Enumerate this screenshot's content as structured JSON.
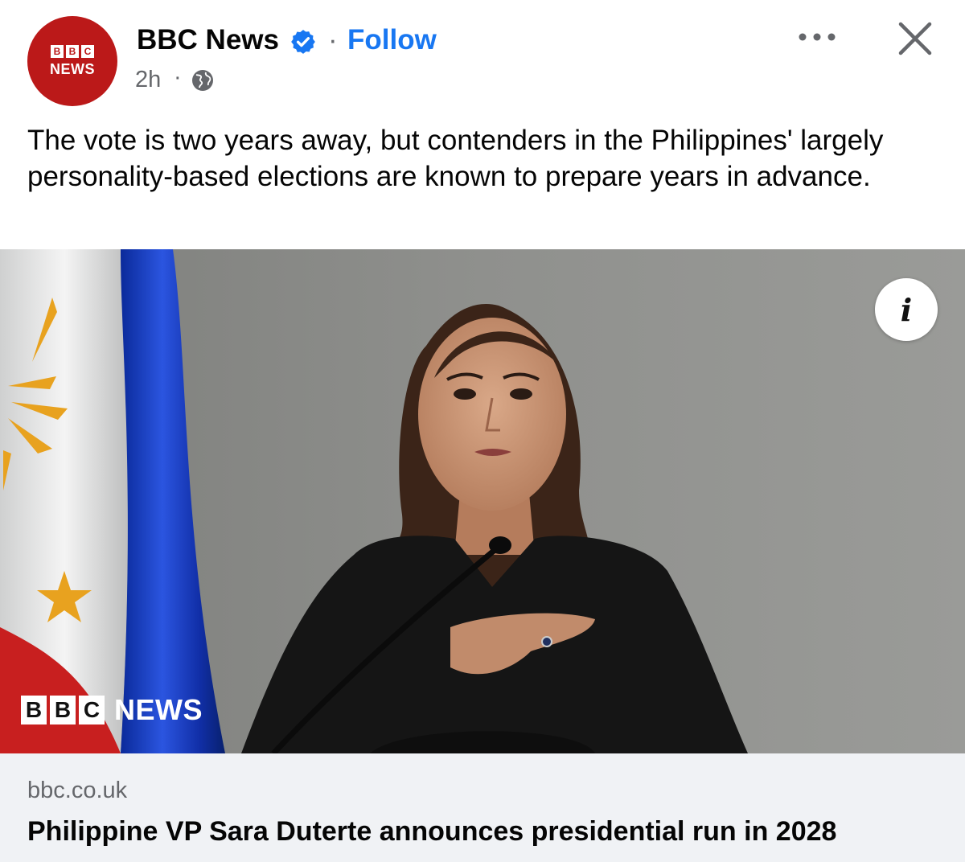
{
  "post": {
    "page_name": "BBC News",
    "follow_label": "Follow",
    "separator": "·",
    "timestamp": "2h",
    "ts_separator": "·",
    "avatar": {
      "blocks": [
        "B",
        "B",
        "C"
      ],
      "label": "NEWS"
    },
    "text": "The vote is two years away, but contenders in the Philippines' largely personality-based elections are known to prepare years in advance."
  },
  "image": {
    "watermark": {
      "blocks": [
        "B",
        "B",
        "C"
      ],
      "label": "NEWS"
    },
    "info_glyph": "i"
  },
  "link": {
    "domain": "bbc.co.uk",
    "headline": "Philippine VP Sara Duterte announces presidential run in 2028"
  },
  "icons": [
    "verified-badge-icon",
    "globe-icon",
    "more-options-icon",
    "close-icon",
    "info-icon"
  ],
  "colors": {
    "brand_red": "#bb1919",
    "follow_blue": "#1877f2",
    "verified_blue": "#1877f2",
    "text_primary": "#050505",
    "text_secondary": "#65676b",
    "preview_bg": "#f0f2f5"
  }
}
